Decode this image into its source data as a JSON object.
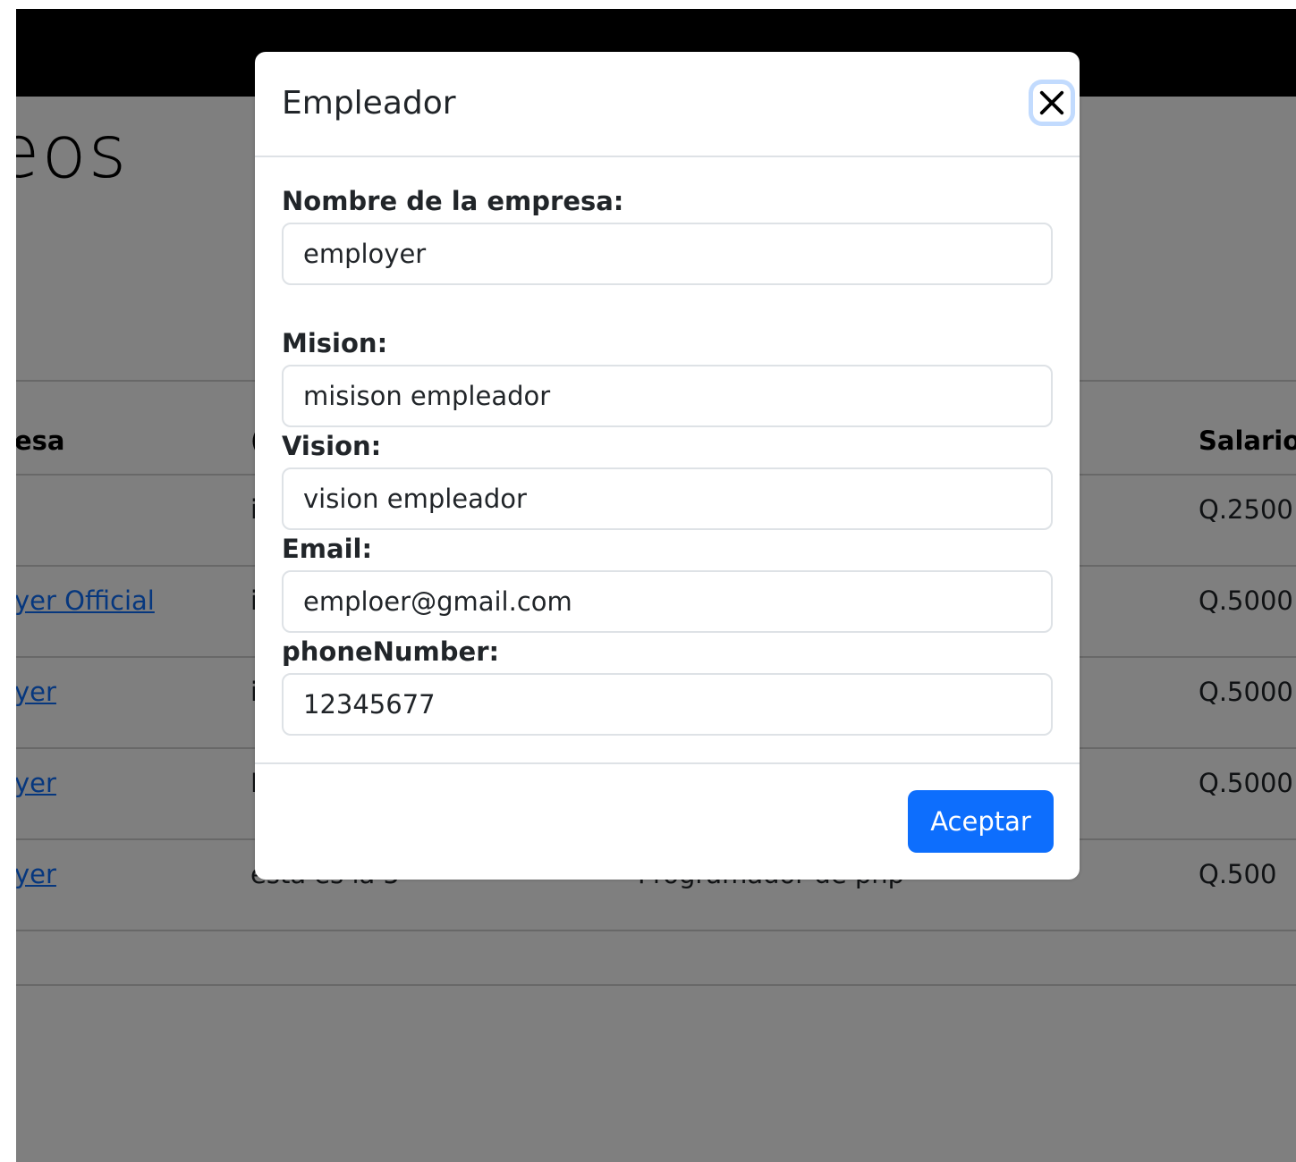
{
  "background": {
    "heading": "eos",
    "table": {
      "headers": {
        "col1": "esa",
        "col2": "(",
        "col5": "Salario"
      },
      "rows": [
        {
          "company": "",
          "col2": "i",
          "salary": "Q.2500"
        },
        {
          "company": "yer Official",
          "col2": "i",
          "salary": "Q.5000"
        },
        {
          "company": "yer",
          "col2": "i",
          "salary": "Q.5000"
        },
        {
          "company": "yer",
          "col2": "I",
          "salary": "Q.5000"
        },
        {
          "company": "yer",
          "col2": "esta es la 5",
          "col3": "Programador de php",
          "salary": "Q.500"
        }
      ]
    }
  },
  "modal": {
    "title": "Empleador",
    "close_icon": "close-icon",
    "fields": {
      "company_name": {
        "label": "Nombre de la empresa:",
        "value": "employer"
      },
      "mission": {
        "label": "Mision:",
        "value": "misison empleador"
      },
      "vision": {
        "label": "Vision:",
        "value": "vision empleador"
      },
      "email": {
        "label": "Email:",
        "value": "emploer@gmail.com"
      },
      "phone": {
        "label": "phoneNumber:",
        "value": "12345677"
      }
    },
    "accept_label": "Aceptar"
  },
  "colors": {
    "primary": "#0d6efd",
    "navbar": "#000000",
    "backdrop": "rgba(0,0,0,0.5)"
  }
}
